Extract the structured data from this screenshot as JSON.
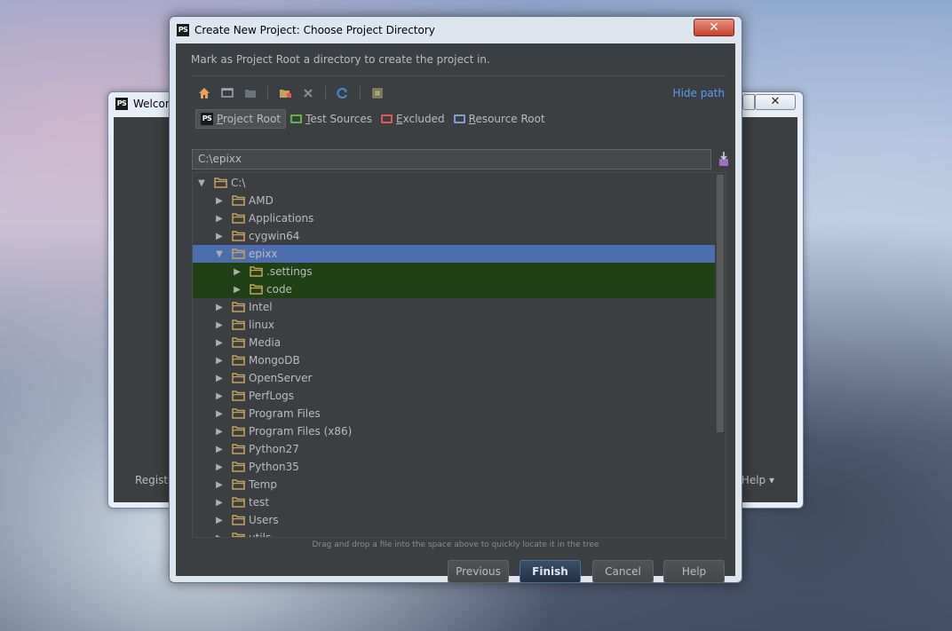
{
  "welcome_window": {
    "title": "Welcome to PyCharm",
    "close_glyph": "✕",
    "register_label": "Register...",
    "help_label": "Help ▾"
  },
  "dialog": {
    "app_icon": "PS",
    "title": "Create New Project: Choose Project Directory",
    "close_glyph": "✕",
    "subtitle": "Mark as Project Root a directory to create the project in.",
    "hide_path": "Hide path",
    "toolbar": [
      {
        "icon": "home-icon"
      },
      {
        "icon": "desktop-icon"
      },
      {
        "icon": "project-folder-icon"
      },
      {
        "icon": "new-folder-icon"
      },
      {
        "icon": "delete-icon"
      },
      {
        "icon": "refresh-icon"
      },
      {
        "icon": "show-hidden-icon"
      }
    ],
    "marks": [
      {
        "label_first": "P",
        "label_rest": "roject Root",
        "color": "#c4c4c4",
        "active": true
      },
      {
        "label_first": "T",
        "label_rest": "est Sources",
        "color": "#62b543",
        "active": false
      },
      {
        "label_first": "E",
        "label_rest": "xcluded",
        "color": "#e05555",
        "active": false
      },
      {
        "label_first": "R",
        "label_rest": "esource Root",
        "color": "#7f9cd6",
        "active": false
      }
    ],
    "path_value": "C:\\epixx",
    "tree": [
      {
        "label": "C:\\",
        "expanded": true,
        "level": 0
      },
      {
        "label": "AMD",
        "expanded": false,
        "level": 1
      },
      {
        "label": "Applications",
        "expanded": false,
        "level": 1
      },
      {
        "label": "cygwin64",
        "expanded": false,
        "level": 1
      },
      {
        "label": "epixx",
        "expanded": true,
        "level": 1,
        "state": "selected"
      },
      {
        "label": ".settings",
        "expanded": false,
        "level": 2,
        "state": "project"
      },
      {
        "label": "code",
        "expanded": false,
        "level": 2,
        "state": "project"
      },
      {
        "label": "Intel",
        "expanded": false,
        "level": 1
      },
      {
        "label": "linux",
        "expanded": false,
        "level": 1
      },
      {
        "label": "Media",
        "expanded": false,
        "level": 1
      },
      {
        "label": "MongoDB",
        "expanded": false,
        "level": 1
      },
      {
        "label": "OpenServer",
        "expanded": false,
        "level": 1
      },
      {
        "label": "PerfLogs",
        "expanded": false,
        "level": 1
      },
      {
        "label": "Program Files",
        "expanded": false,
        "level": 1
      },
      {
        "label": "Program Files (x86)",
        "expanded": false,
        "level": 1
      },
      {
        "label": "Python27",
        "expanded": false,
        "level": 1
      },
      {
        "label": "Python35",
        "expanded": false,
        "level": 1
      },
      {
        "label": "Temp",
        "expanded": false,
        "level": 1
      },
      {
        "label": "test",
        "expanded": false,
        "level": 1
      },
      {
        "label": "Users",
        "expanded": false,
        "level": 1
      },
      {
        "label": "utils",
        "expanded": false,
        "level": 1
      }
    ],
    "hint": "Drag and drop a file into the space above to quickly locate it in the tree",
    "buttons": {
      "previous": "Previous",
      "finish": "Finish",
      "cancel": "Cancel",
      "help": "Help"
    },
    "colors": {
      "selection": "#4b6eaf",
      "project_highlight": "#1e4213",
      "folder": "#c8a25a",
      "link": "#589df6"
    }
  }
}
